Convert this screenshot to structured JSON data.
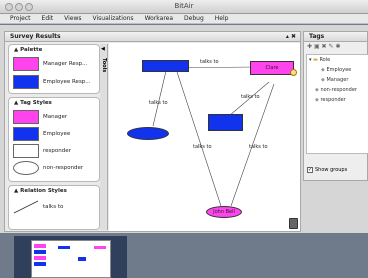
{
  "window": {
    "title": "BitAir"
  },
  "menu": [
    "Project",
    "Edit",
    "Views",
    "Visualizations",
    "Workarea",
    "Debug",
    "Help"
  ],
  "panel": {
    "title": "Survey Results",
    "tools_tab": "Tools"
  },
  "palette": {
    "title": "Palette",
    "items": [
      {
        "label": "Manager Resp...",
        "color": "#ff44ee"
      },
      {
        "label": "Employee Resp...",
        "color": "#1133ee"
      }
    ]
  },
  "tag_styles": {
    "title": "Tag Styles",
    "items": [
      {
        "label": "Manager",
        "color": "#ff44ee"
      },
      {
        "label": "Employee",
        "color": "#1133ee"
      },
      {
        "label": "responder",
        "color": "#ffffff"
      },
      {
        "label": "non-responder",
        "color": "#ffffff"
      }
    ]
  },
  "relation_styles": {
    "title": "Relation Styles",
    "items": [
      {
        "label": "talks to"
      }
    ]
  },
  "graph": {
    "nodes": {
      "top_blue": "",
      "clare": "Clare",
      "mid_blue": "",
      "ellipse_left": "",
      "john_bell": "John Bell"
    },
    "edge_labels": [
      "talks to",
      "talks to",
      "talks to",
      "talks to",
      "talks to"
    ]
  },
  "tags_panel": {
    "title": "Tags",
    "tree": {
      "root": "Role",
      "children": [
        "Employee",
        "Manager",
        "non-responder",
        "responder"
      ]
    },
    "show_groups": {
      "label": "Show groups",
      "checked": true
    }
  }
}
